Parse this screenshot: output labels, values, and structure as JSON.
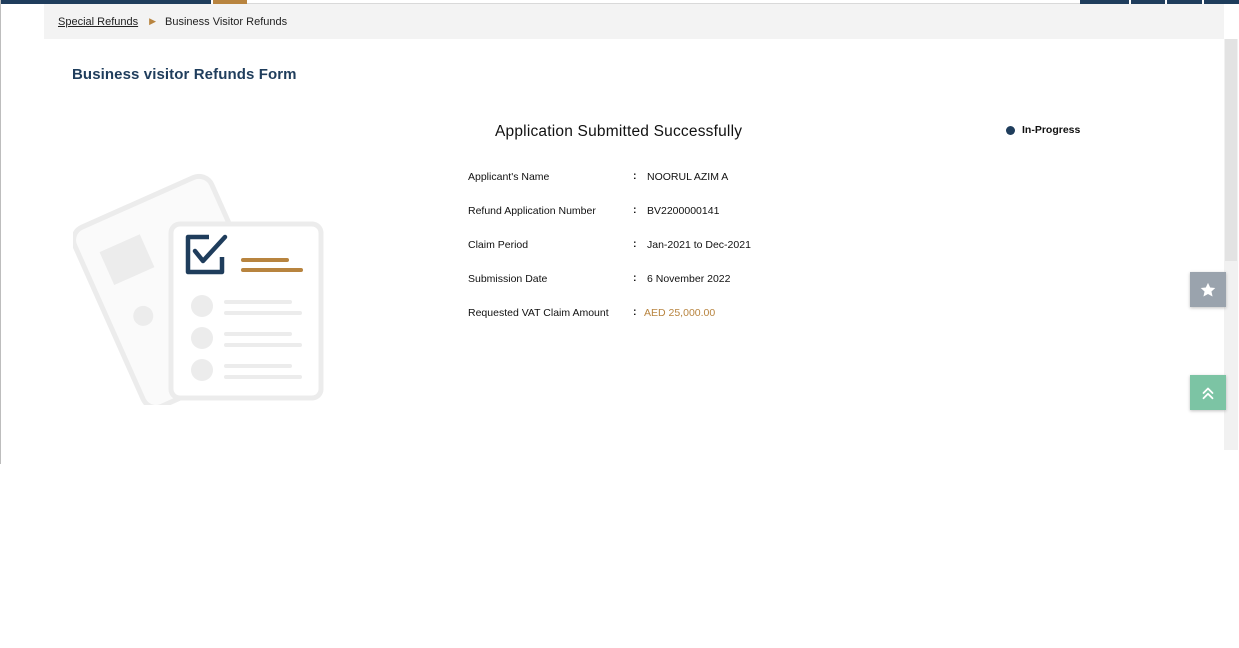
{
  "breadcrumb": {
    "link": "Special Refunds",
    "separator": "▶",
    "current": "Business Visitor Refunds"
  },
  "page": {
    "title": "Business visitor Refunds Form"
  },
  "confirmation": {
    "title": "Application Submitted Successfully",
    "status": "In-Progress",
    "fields": [
      {
        "label": "Applicant's Name",
        "value": "NOORUL AZIM A"
      },
      {
        "label": "Refund Application Number",
        "value": "BV2200000141"
      },
      {
        "label": "Claim Period",
        "value": "Jan-2021 to Dec-2021"
      },
      {
        "label": "Submission Date",
        "value": "6 November 2022"
      },
      {
        "label": "Requested VAT Claim Amount",
        "value": "AED 25,000.00"
      }
    ],
    "colon": ":"
  },
  "colors": {
    "navy": "#1f3d5c",
    "gold": "#b8843f",
    "fab_favorites": "#9aa3ad",
    "fab_top": "#7cc4a4"
  },
  "icons": {
    "favorites": "star-icon",
    "scroll_top": "double-chevron-up-icon",
    "illustration": "checklist-document-icon"
  }
}
